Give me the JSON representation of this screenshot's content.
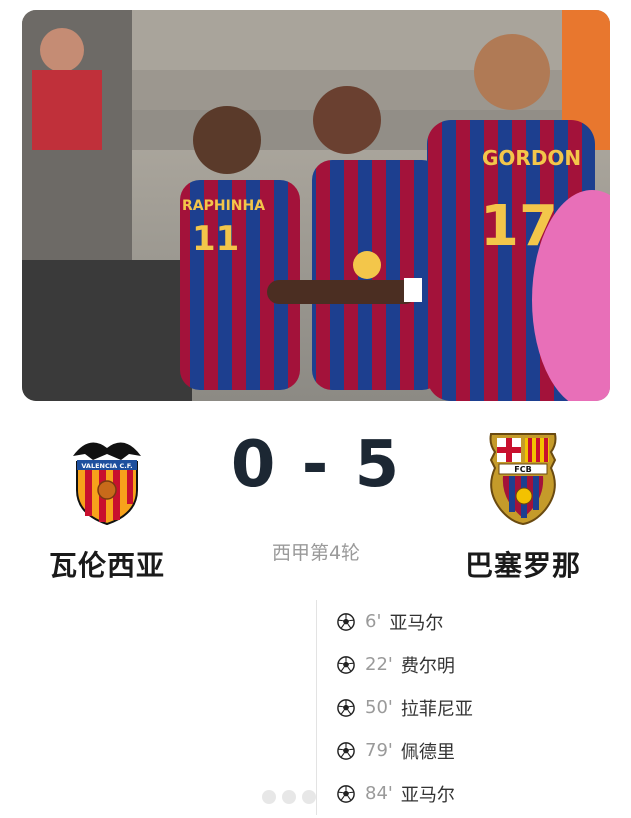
{
  "match": {
    "home_team": "瓦伦西亚",
    "away_team": "巴塞罗那",
    "score": "0 - 5",
    "round": "西甲第4轮"
  },
  "photo": {
    "jersey_text_1": "GORDON",
    "jersey_number_1": "17",
    "jersey_text_2": "RAPHINHA",
    "jersey_number_2": "11"
  },
  "goals": [
    {
      "minute": "6'",
      "scorer": "亚马尔"
    },
    {
      "minute": "22'",
      "scorer": "费尔明"
    },
    {
      "minute": "50'",
      "scorer": "拉菲尼亚"
    },
    {
      "minute": "79'",
      "scorer": "佩德里"
    },
    {
      "minute": "84'",
      "scorer": "亚马尔"
    }
  ],
  "crests": {
    "home_text": "VALENCIA C.F.",
    "away_text": "FCB"
  },
  "colors": {
    "barca_blue": "#1d3f8f",
    "barca_red": "#a3123a",
    "valencia_orange": "#f7a21b",
    "score_color": "#1c2733"
  }
}
